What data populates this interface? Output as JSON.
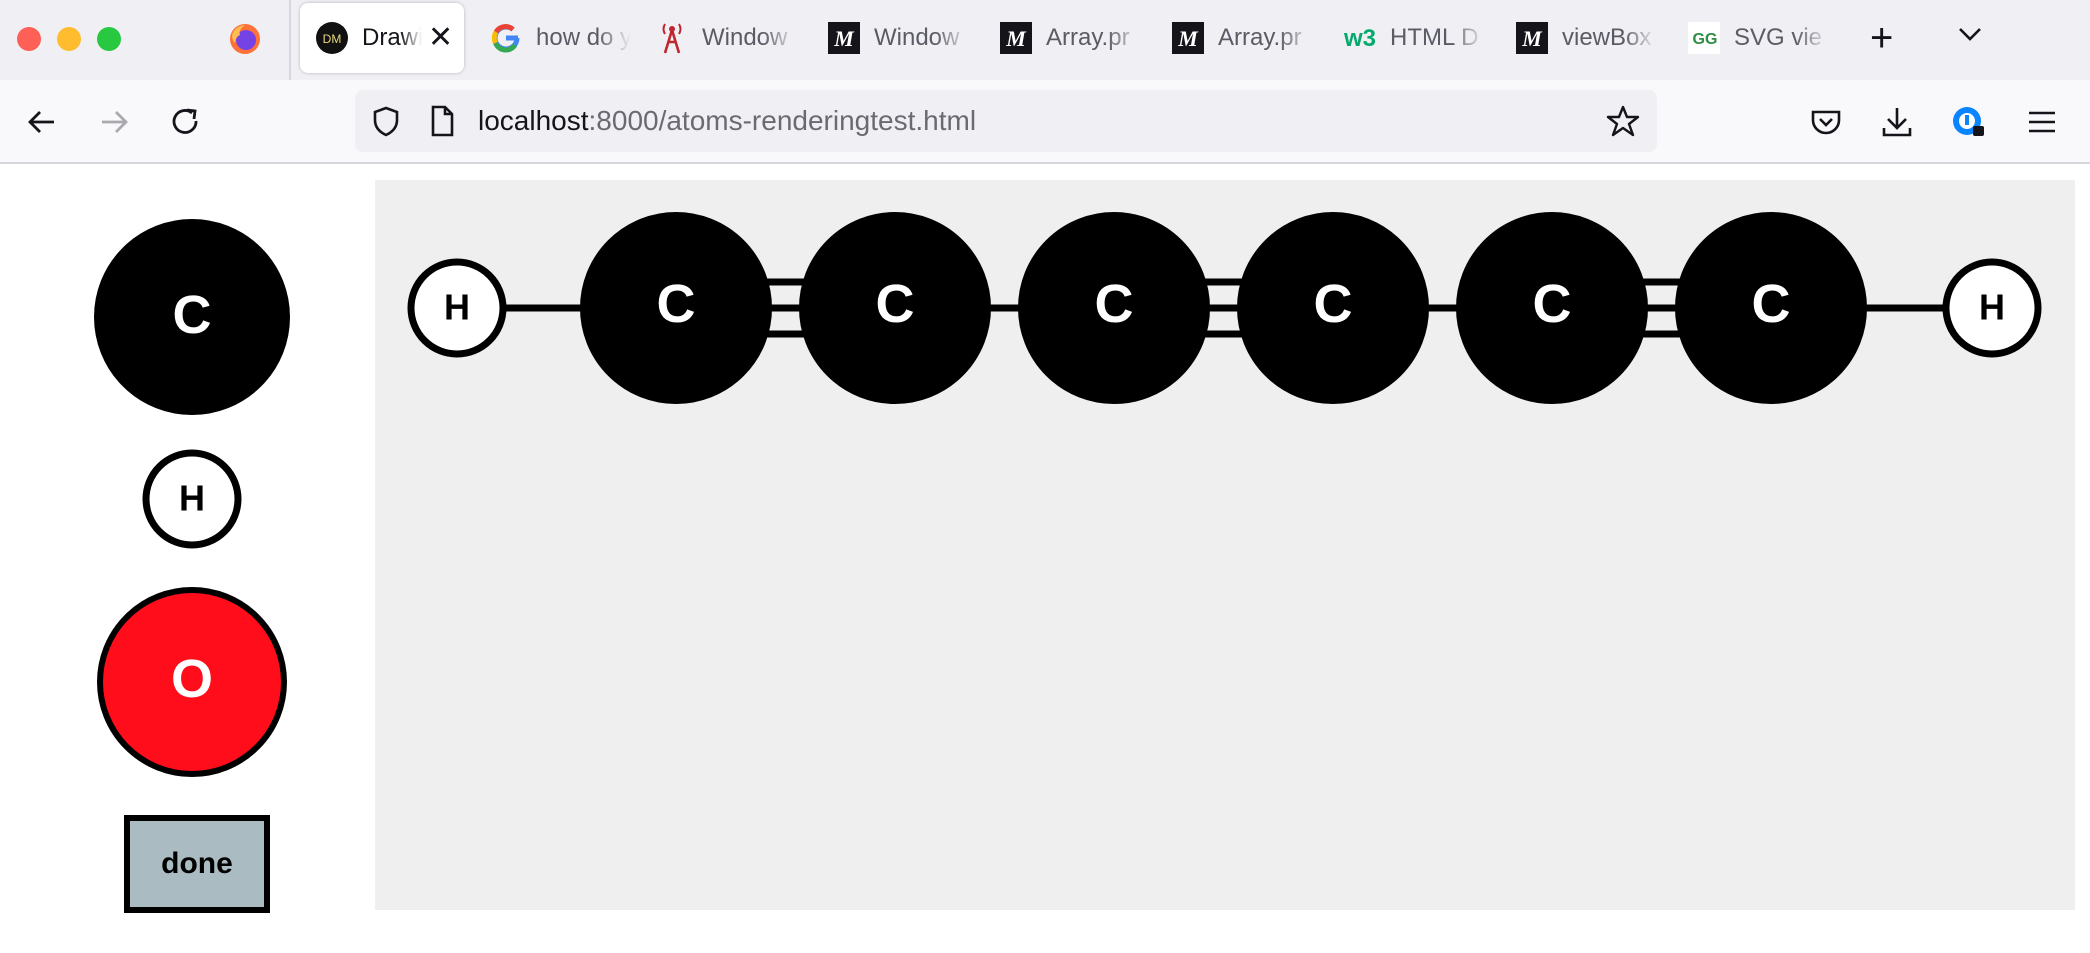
{
  "browser": {
    "tabs": [
      {
        "title": "Drawi",
        "icon": "dm-favicon",
        "active": true
      },
      {
        "title": "how do y",
        "icon": "google-icon"
      },
      {
        "title": "Window",
        "icon": "tower-icon"
      },
      {
        "title": "Window",
        "icon": "mdn-icon"
      },
      {
        "title": "Array.pr",
        "icon": "mdn-icon"
      },
      {
        "title": "Array.pr",
        "icon": "mdn-icon"
      },
      {
        "title": "HTML D",
        "icon": "w3schools-icon"
      },
      {
        "title": "viewBox",
        "icon": "mdn-icon"
      },
      {
        "title": "SVG vie",
        "icon": "geeksforgeeks-icon"
      }
    ],
    "favicon_text": {
      "dm": "DM",
      "mdn": "M",
      "w3": "w3",
      "gfg": "GG"
    },
    "url_host": "localhost",
    "url_rest": ":8000/atoms-renderingtest.html"
  },
  "palette": {
    "atoms": [
      {
        "symbol": "C",
        "fill": "#000000",
        "text": "#ffffff"
      },
      {
        "symbol": "H",
        "fill": "#ffffff",
        "text": "#000000"
      },
      {
        "symbol": "O",
        "fill": "#ff0d1a",
        "text": "#ffffff"
      }
    ],
    "done_label": "done"
  },
  "molecule": {
    "atoms": [
      "H",
      "C",
      "C",
      "C",
      "C",
      "C",
      "C",
      "H"
    ],
    "bond_orders": [
      1,
      3,
      1,
      3,
      1,
      3,
      1
    ],
    "colors": {
      "C": "#000000",
      "H": "#ffffff",
      "bond": "#000000",
      "canvas": "#efefef"
    }
  }
}
